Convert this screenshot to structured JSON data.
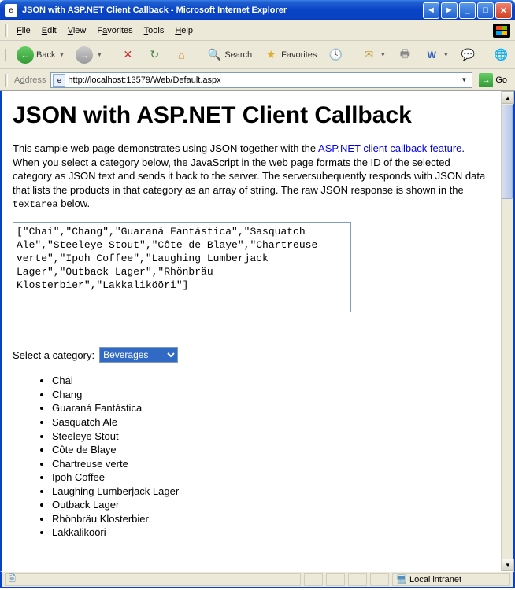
{
  "window": {
    "title": "JSON with ASP.NET Client Callback - Microsoft Internet Explorer"
  },
  "menus": {
    "file": "File",
    "edit": "Edit",
    "view": "View",
    "favorites": "Favorites",
    "tools": "Tools",
    "help": "Help"
  },
  "toolbar": {
    "back": "Back",
    "search": "Search",
    "favorites": "Favorites"
  },
  "address": {
    "label": "Address",
    "url": "http://localhost:13579/Web/Default.aspx",
    "go": "Go"
  },
  "page": {
    "heading": "JSON with ASP.NET Client Callback",
    "para1_a": "This sample web page demonstrates using JSON together with the ",
    "link": "ASP.NET client callback feature",
    "para1_b": ". When you select a category below, the JavaScript in the web page formats the ID of the selected category as JSON text and sends it back to the server. The serversubequently responds with JSON data that lists the products in that category as an array of string. The raw JSON response is shown in the ",
    "code": "textarea",
    "para1_c": " below.",
    "json_response": "[\"Chai\",\"Chang\",\"Guaraná Fantástica\",\"Sasquatch Ale\",\"Steeleye Stout\",\"Côte de Blaye\",\"Chartreuse verte\",\"Ipoh Coffee\",\"Laughing Lumberjack Lager\",\"Outback Lager\",\"Rhönbräu Klosterbier\",\"Lakkalikööri\"]",
    "select_label": "Select a category:",
    "selected_category": "Beverages",
    "products": [
      "Chai",
      "Chang",
      "Guaraná Fantástica",
      "Sasquatch Ale",
      "Steeleye Stout",
      "Côte de Blaye",
      "Chartreuse verte",
      "Ipoh Coffee",
      "Laughing Lumberjack Lager",
      "Outback Lager",
      "Rhönbräu Klosterbier",
      "Lakkalikööri"
    ]
  },
  "status": {
    "zone": "Local intranet"
  }
}
